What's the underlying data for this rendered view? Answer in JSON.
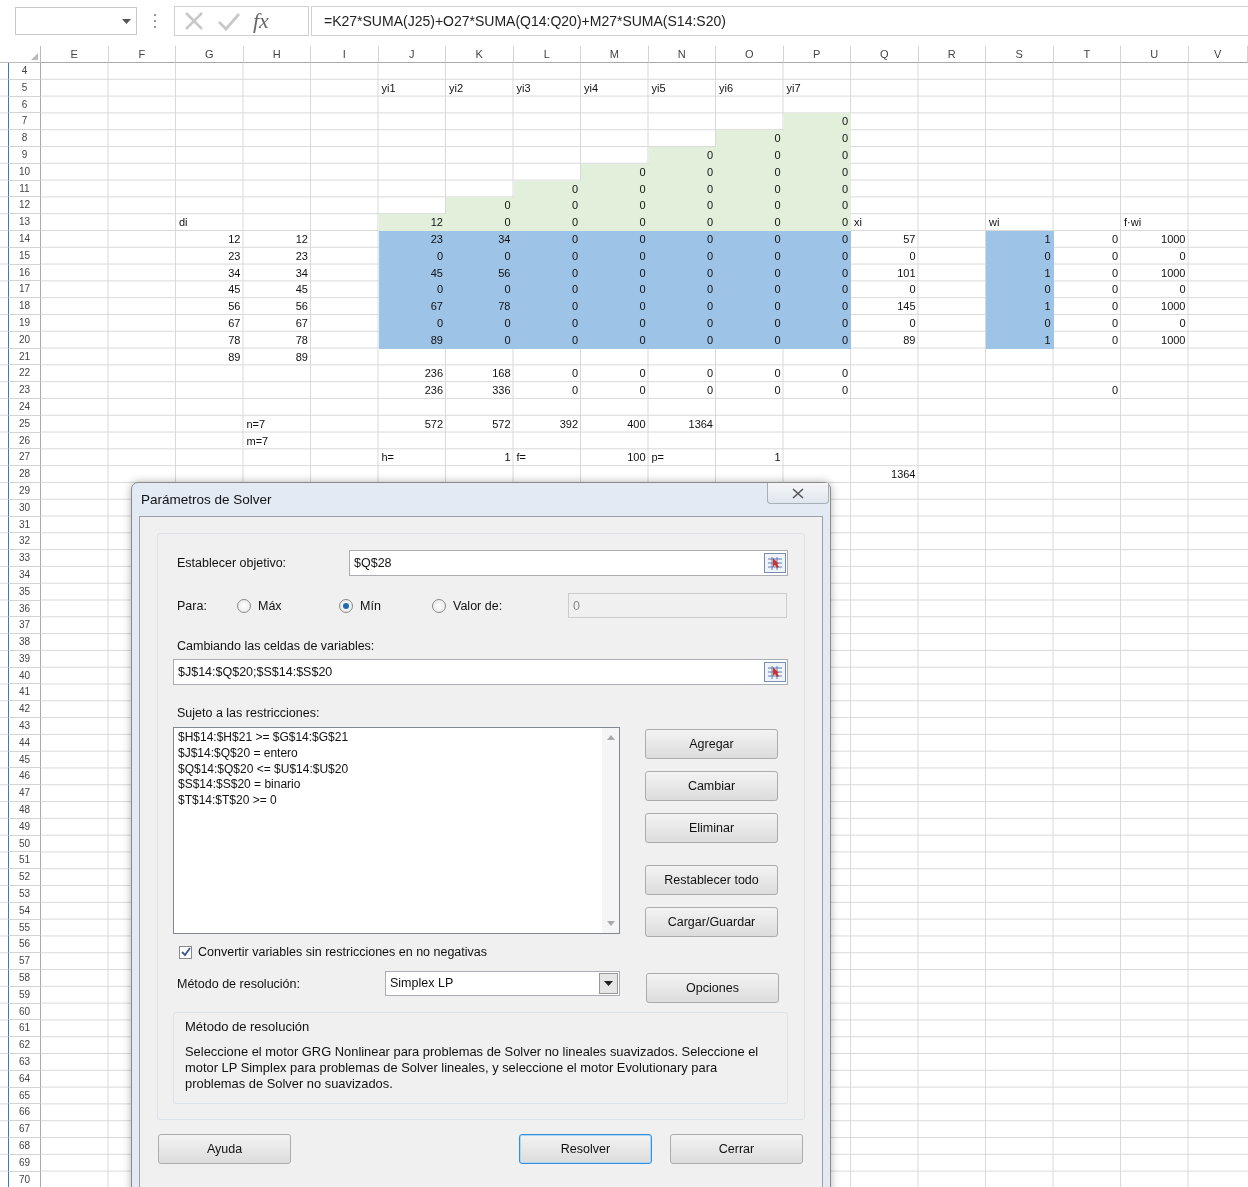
{
  "formula_bar": {
    "function_button": "fx",
    "formula": "=K27*SUMA(J25)+O27*SUMA(Q14:Q20)+M27*SUMA(S14:S20)"
  },
  "sheet": {
    "columns": [
      "E",
      "F",
      "G",
      "H",
      "I",
      "J",
      "K",
      "L",
      "M",
      "N",
      "O",
      "P",
      "Q",
      "R",
      "S",
      "T",
      "U",
      "V"
    ],
    "rows": [
      {
        "number": "4"
      },
      {
        "number": "5",
        "cells": {
          "J": {
            "kind": "label",
            "text": "yi1"
          },
          "K": {
            "kind": "label",
            "text": "yi2"
          },
          "L": {
            "kind": "label",
            "text": "yi3"
          },
          "M": {
            "kind": "label",
            "text": "yi4"
          },
          "N": {
            "kind": "label",
            "text": "yi5"
          },
          "O": {
            "kind": "label",
            "text": "yi6"
          },
          "P": {
            "kind": "label",
            "text": "yi7"
          }
        }
      },
      {
        "number": "6"
      },
      {
        "number": "7",
        "cells": {
          "P": {
            "kind": "number",
            "text": "0",
            "color": "#e2efda"
          }
        }
      },
      {
        "number": "8",
        "cells": {
          "O": {
            "kind": "number",
            "text": "0",
            "color": "#e2efda"
          },
          "P": {
            "kind": "number",
            "text": "0",
            "color": "#e2efda"
          }
        }
      },
      {
        "number": "9",
        "cells": {
          "N": {
            "kind": "number",
            "text": "0",
            "color": "#e2efda"
          },
          "O": {
            "kind": "number",
            "text": "0",
            "color": "#e2efda"
          },
          "P": {
            "kind": "number",
            "text": "0",
            "color": "#e2efda"
          }
        }
      },
      {
        "number": "10",
        "cells": {
          "M": {
            "kind": "number",
            "text": "0",
            "color": "#e2efda"
          },
          "N": {
            "kind": "number",
            "text": "0",
            "color": "#e2efda"
          },
          "O": {
            "kind": "number",
            "text": "0",
            "color": "#e2efda"
          },
          "P": {
            "kind": "number",
            "text": "0",
            "color": "#e2efda"
          }
        }
      },
      {
        "number": "11",
        "cells": {
          "L": {
            "kind": "number",
            "text": "0",
            "color": "#e2efda"
          },
          "M": {
            "kind": "number",
            "text": "0",
            "color": "#e2efda"
          },
          "N": {
            "kind": "number",
            "text": "0",
            "color": "#e2efda"
          },
          "O": {
            "kind": "number",
            "text": "0",
            "color": "#e2efda"
          },
          "P": {
            "kind": "number",
            "text": "0",
            "color": "#e2efda"
          }
        }
      },
      {
        "number": "12",
        "cells": {
          "K": {
            "kind": "number",
            "text": "0",
            "color": "#e2efda"
          },
          "L": {
            "kind": "number",
            "text": "0",
            "color": "#e2efda"
          },
          "M": {
            "kind": "number",
            "text": "0",
            "color": "#e2efda"
          },
          "N": {
            "kind": "number",
            "text": "0",
            "color": "#e2efda"
          },
          "O": {
            "kind": "number",
            "text": "0",
            "color": "#e2efda"
          },
          "P": {
            "kind": "number",
            "text": "0",
            "color": "#e2efda"
          }
        }
      },
      {
        "number": "13",
        "cells": {
          "G": {
            "kind": "label",
            "text": "di"
          },
          "J": {
            "kind": "number",
            "text": "12",
            "color": "#e2efda"
          },
          "K": {
            "kind": "number",
            "text": "0",
            "color": "#e2efda"
          },
          "L": {
            "kind": "number",
            "text": "0",
            "color": "#e2efda"
          },
          "M": {
            "kind": "number",
            "text": "0",
            "color": "#e2efda"
          },
          "N": {
            "kind": "number",
            "text": "0",
            "color": "#e2efda"
          },
          "O": {
            "kind": "number",
            "text": "0",
            "color": "#e2efda"
          },
          "P": {
            "kind": "number",
            "text": "0",
            "color": "#e2efda"
          },
          "Q": {
            "kind": "label",
            "text": "xi"
          },
          "S": {
            "kind": "label",
            "text": "wi"
          },
          "U": {
            "kind": "label",
            "text": "f·wi"
          }
        }
      },
      {
        "number": "14",
        "cells": {
          "G": {
            "kind": "number",
            "text": "12"
          },
          "H": {
            "kind": "number",
            "text": "12"
          },
          "J": {
            "kind": "number",
            "text": "23",
            "color": "#9dc3e6"
          },
          "K": {
            "kind": "number",
            "text": "34",
            "color": "#9dc3e6"
          },
          "L": {
            "kind": "number",
            "text": "0",
            "color": "#9dc3e6"
          },
          "M": {
            "kind": "number",
            "text": "0",
            "color": "#9dc3e6"
          },
          "N": {
            "kind": "number",
            "text": "0",
            "color": "#9dc3e6"
          },
          "O": {
            "kind": "number",
            "text": "0",
            "color": "#9dc3e6"
          },
          "P": {
            "kind": "number",
            "text": "0",
            "color": "#9dc3e6"
          },
          "Q": {
            "kind": "number",
            "text": "57"
          },
          "S": {
            "kind": "number",
            "text": "1",
            "color": "#9dc3e6"
          },
          "T": {
            "kind": "number",
            "text": "0"
          },
          "U": {
            "kind": "number",
            "text": "1000"
          }
        }
      },
      {
        "number": "15",
        "cells": {
          "G": {
            "kind": "number",
            "text": "23"
          },
          "H": {
            "kind": "number",
            "text": "23"
          },
          "J": {
            "kind": "number",
            "text": "0",
            "color": "#9dc3e6"
          },
          "K": {
            "kind": "number",
            "text": "0",
            "color": "#9dc3e6"
          },
          "L": {
            "kind": "number",
            "text": "0",
            "color": "#9dc3e6"
          },
          "M": {
            "kind": "number",
            "text": "0",
            "color": "#9dc3e6"
          },
          "N": {
            "kind": "number",
            "text": "0",
            "color": "#9dc3e6"
          },
          "O": {
            "kind": "number",
            "text": "0",
            "color": "#9dc3e6"
          },
          "P": {
            "kind": "number",
            "text": "0",
            "color": "#9dc3e6"
          },
          "Q": {
            "kind": "number",
            "text": "0"
          },
          "S": {
            "kind": "number",
            "text": "0",
            "color": "#9dc3e6"
          },
          "T": {
            "kind": "number",
            "text": "0"
          },
          "U": {
            "kind": "number",
            "text": "0"
          }
        }
      },
      {
        "number": "16",
        "cells": {
          "G": {
            "kind": "number",
            "text": "34"
          },
          "H": {
            "kind": "number",
            "text": "34"
          },
          "J": {
            "kind": "number",
            "text": "45",
            "color": "#9dc3e6"
          },
          "K": {
            "kind": "number",
            "text": "56",
            "color": "#9dc3e6"
          },
          "L": {
            "kind": "number",
            "text": "0",
            "color": "#9dc3e6"
          },
          "M": {
            "kind": "number",
            "text": "0",
            "color": "#9dc3e6"
          },
          "N": {
            "kind": "number",
            "text": "0",
            "color": "#9dc3e6"
          },
          "O": {
            "kind": "number",
            "text": "0",
            "color": "#9dc3e6"
          },
          "P": {
            "kind": "number",
            "text": "0",
            "color": "#9dc3e6"
          },
          "Q": {
            "kind": "number",
            "text": "101"
          },
          "S": {
            "kind": "number",
            "text": "1",
            "color": "#9dc3e6"
          },
          "T": {
            "kind": "number",
            "text": "0"
          },
          "U": {
            "kind": "number",
            "text": "1000"
          }
        }
      },
      {
        "number": "17",
        "cells": {
          "G": {
            "kind": "number",
            "text": "45"
          },
          "H": {
            "kind": "number",
            "text": "45"
          },
          "J": {
            "kind": "number",
            "text": "0",
            "color": "#9dc3e6"
          },
          "K": {
            "kind": "number",
            "text": "0",
            "color": "#9dc3e6"
          },
          "L": {
            "kind": "number",
            "text": "0",
            "color": "#9dc3e6"
          },
          "M": {
            "kind": "number",
            "text": "0",
            "color": "#9dc3e6"
          },
          "N": {
            "kind": "number",
            "text": "0",
            "color": "#9dc3e6"
          },
          "O": {
            "kind": "number",
            "text": "0",
            "color": "#9dc3e6"
          },
          "P": {
            "kind": "number",
            "text": "0",
            "color": "#9dc3e6"
          },
          "Q": {
            "kind": "number",
            "text": "0"
          },
          "S": {
            "kind": "number",
            "text": "0",
            "color": "#9dc3e6"
          },
          "T": {
            "kind": "number",
            "text": "0"
          },
          "U": {
            "kind": "number",
            "text": "0"
          }
        }
      },
      {
        "number": "18",
        "cells": {
          "G": {
            "kind": "number",
            "text": "56"
          },
          "H": {
            "kind": "number",
            "text": "56"
          },
          "J": {
            "kind": "number",
            "text": "67",
            "color": "#9dc3e6"
          },
          "K": {
            "kind": "number",
            "text": "78",
            "color": "#9dc3e6"
          },
          "L": {
            "kind": "number",
            "text": "0",
            "color": "#9dc3e6"
          },
          "M": {
            "kind": "number",
            "text": "0",
            "color": "#9dc3e6"
          },
          "N": {
            "kind": "number",
            "text": "0",
            "color": "#9dc3e6"
          },
          "O": {
            "kind": "number",
            "text": "0",
            "color": "#9dc3e6"
          },
          "P": {
            "kind": "number",
            "text": "0",
            "color": "#9dc3e6"
          },
          "Q": {
            "kind": "number",
            "text": "145"
          },
          "S": {
            "kind": "number",
            "text": "1",
            "color": "#9dc3e6"
          },
          "T": {
            "kind": "number",
            "text": "0"
          },
          "U": {
            "kind": "number",
            "text": "1000"
          }
        }
      },
      {
        "number": "19",
        "cells": {
          "G": {
            "kind": "number",
            "text": "67"
          },
          "H": {
            "kind": "number",
            "text": "67"
          },
          "J": {
            "kind": "number",
            "text": "0",
            "color": "#9dc3e6"
          },
          "K": {
            "kind": "number",
            "text": "0",
            "color": "#9dc3e6"
          },
          "L": {
            "kind": "number",
            "text": "0",
            "color": "#9dc3e6"
          },
          "M": {
            "kind": "number",
            "text": "0",
            "color": "#9dc3e6"
          },
          "N": {
            "kind": "number",
            "text": "0",
            "color": "#9dc3e6"
          },
          "O": {
            "kind": "number",
            "text": "0",
            "color": "#9dc3e6"
          },
          "P": {
            "kind": "number",
            "text": "0",
            "color": "#9dc3e6"
          },
          "Q": {
            "kind": "number",
            "text": "0"
          },
          "S": {
            "kind": "number",
            "text": "0",
            "color": "#9dc3e6"
          },
          "T": {
            "kind": "number",
            "text": "0"
          },
          "U": {
            "kind": "number",
            "text": "0"
          }
        }
      },
      {
        "number": "20",
        "cells": {
          "G": {
            "kind": "number",
            "text": "78"
          },
          "H": {
            "kind": "number",
            "text": "78"
          },
          "J": {
            "kind": "number",
            "text": "89",
            "color": "#9dc3e6"
          },
          "K": {
            "kind": "number",
            "text": "0",
            "color": "#9dc3e6"
          },
          "L": {
            "kind": "number",
            "text": "0",
            "color": "#9dc3e6"
          },
          "M": {
            "kind": "number",
            "text": "0",
            "color": "#9dc3e6"
          },
          "N": {
            "kind": "number",
            "text": "0",
            "color": "#9dc3e6"
          },
          "O": {
            "kind": "number",
            "text": "0",
            "color": "#9dc3e6"
          },
          "P": {
            "kind": "number",
            "text": "0",
            "color": "#9dc3e6"
          },
          "Q": {
            "kind": "number",
            "text": "89"
          },
          "S": {
            "kind": "number",
            "text": "1",
            "color": "#9dc3e6"
          },
          "T": {
            "kind": "number",
            "text": "0"
          },
          "U": {
            "kind": "number",
            "text": "1000"
          }
        }
      },
      {
        "number": "21",
        "cells": {
          "G": {
            "kind": "number",
            "text": "89"
          },
          "H": {
            "kind": "number",
            "text": "89"
          }
        }
      },
      {
        "number": "22",
        "cells": {
          "J": {
            "kind": "number",
            "text": "236"
          },
          "K": {
            "kind": "number",
            "text": "168"
          },
          "L": {
            "kind": "number",
            "text": "0"
          },
          "M": {
            "kind": "number",
            "text": "0"
          },
          "N": {
            "kind": "number",
            "text": "0"
          },
          "O": {
            "kind": "number",
            "text": "0"
          },
          "P": {
            "kind": "number",
            "text": "0"
          }
        }
      },
      {
        "number": "23",
        "cells": {
          "J": {
            "kind": "number",
            "text": "236"
          },
          "K": {
            "kind": "number",
            "text": "336"
          },
          "L": {
            "kind": "number",
            "text": "0"
          },
          "M": {
            "kind": "number",
            "text": "0"
          },
          "N": {
            "kind": "number",
            "text": "0"
          },
          "O": {
            "kind": "number",
            "text": "0"
          },
          "P": {
            "kind": "number",
            "text": "0"
          },
          "T": {
            "kind": "number",
            "text": "0"
          }
        }
      },
      {
        "number": "24"
      },
      {
        "number": "25",
        "cells": {
          "H": {
            "kind": "label",
            "text": "n=7"
          },
          "J": {
            "kind": "number",
            "text": "572"
          },
          "K": {
            "kind": "number",
            "text": "572"
          },
          "L": {
            "kind": "number",
            "text": "392"
          },
          "M": {
            "kind": "number",
            "text": "400"
          },
          "N": {
            "kind": "number",
            "text": "1364"
          }
        }
      },
      {
        "number": "26",
        "cells": {
          "H": {
            "kind": "label",
            "text": "m=7"
          }
        }
      },
      {
        "number": "27",
        "cells": {
          "J": {
            "kind": "label",
            "text": "h="
          },
          "K": {
            "kind": "number",
            "text": "1"
          },
          "L": {
            "kind": "label",
            "text": "f="
          },
          "M": {
            "kind": "number",
            "text": "100"
          },
          "N": {
            "kind": "label",
            "text": "p="
          },
          "O": {
            "kind": "number",
            "text": "1"
          }
        }
      },
      {
        "number": "28",
        "cells": {
          "Q": {
            "kind": "number",
            "text": "1364"
          }
        }
      },
      {
        "number": "29"
      },
      {
        "number": "30"
      },
      {
        "number": "31"
      },
      {
        "number": "32"
      },
      {
        "number": "33"
      },
      {
        "number": "34"
      },
      {
        "number": "35"
      },
      {
        "number": "36"
      },
      {
        "number": "37"
      },
      {
        "number": "38"
      },
      {
        "number": "39"
      },
      {
        "number": "40"
      },
      {
        "number": "41"
      },
      {
        "number": "42"
      },
      {
        "number": "43"
      },
      {
        "number": "44"
      },
      {
        "number": "45"
      },
      {
        "number": "46"
      },
      {
        "number": "47"
      },
      {
        "number": "48"
      },
      {
        "number": "49"
      },
      {
        "number": "50"
      },
      {
        "number": "51"
      },
      {
        "number": "52"
      },
      {
        "number": "53"
      },
      {
        "number": "54"
      },
      {
        "number": "55"
      },
      {
        "number": "56"
      },
      {
        "number": "57"
      },
      {
        "number": "58"
      },
      {
        "number": "59"
      },
      {
        "number": "60"
      },
      {
        "number": "61"
      },
      {
        "number": "62"
      },
      {
        "number": "63"
      },
      {
        "number": "64"
      },
      {
        "number": "65"
      },
      {
        "number": "66"
      },
      {
        "number": "67"
      },
      {
        "number": "68"
      },
      {
        "number": "69"
      },
      {
        "number": "70"
      }
    ]
  },
  "dialog": {
    "title": "Parámetros de Solver",
    "objective": {
      "label": "Establecer objetivo:",
      "value": "$Q$28"
    },
    "para": {
      "label": "Para:",
      "options": [
        {
          "label": "Máx",
          "selected": false
        },
        {
          "label": "Mín",
          "selected": true
        },
        {
          "label": "Valor de:",
          "selected": false
        }
      ],
      "value_field": {
        "value": "0",
        "disabled": true
      }
    },
    "variables": {
      "label": "Cambiando las celdas de variables:",
      "value": "$J$14:$Q$20;$S$14:$S$20"
    },
    "constraints": {
      "label": "Sujeto a las restricciones:",
      "items": [
        "$H$14:$H$21 >= $G$14:$G$21",
        "$J$14:$Q$20 = entero",
        "$Q$14:$Q$20 <= $U$14:$U$20",
        "$S$14:$S$20 = binario",
        "$T$14:$T$20 >= 0"
      ]
    },
    "side_buttons": [
      {
        "label": "Agregar"
      },
      {
        "label": "Cambiar"
      },
      {
        "label": "Eliminar"
      },
      {
        "label": "Restablecer todo"
      },
      {
        "label": "Cargar/Guardar"
      }
    ],
    "nonnegative": {
      "label": "Convertir variables sin restricciones en no negativas",
      "checked": true
    },
    "method": {
      "label": "Método de resolución:",
      "value": "Simplex LP"
    },
    "options_button": {
      "label": "Opciones"
    },
    "info": {
      "title": "Método de resolución",
      "text": "Seleccione el motor GRG Nonlinear para problemas de Solver no lineales suavizados. Seleccione el motor LP Simplex para problemas de Solver lineales, y seleccione el motor Evolutionary para problemas de Solver no suavizados."
    },
    "footer_buttons": [
      {
        "label": "Ayuda",
        "default": false
      },
      {
        "label": "Resolver",
        "default": true
      },
      {
        "label": "Cerrar",
        "default": false
      }
    ]
  }
}
